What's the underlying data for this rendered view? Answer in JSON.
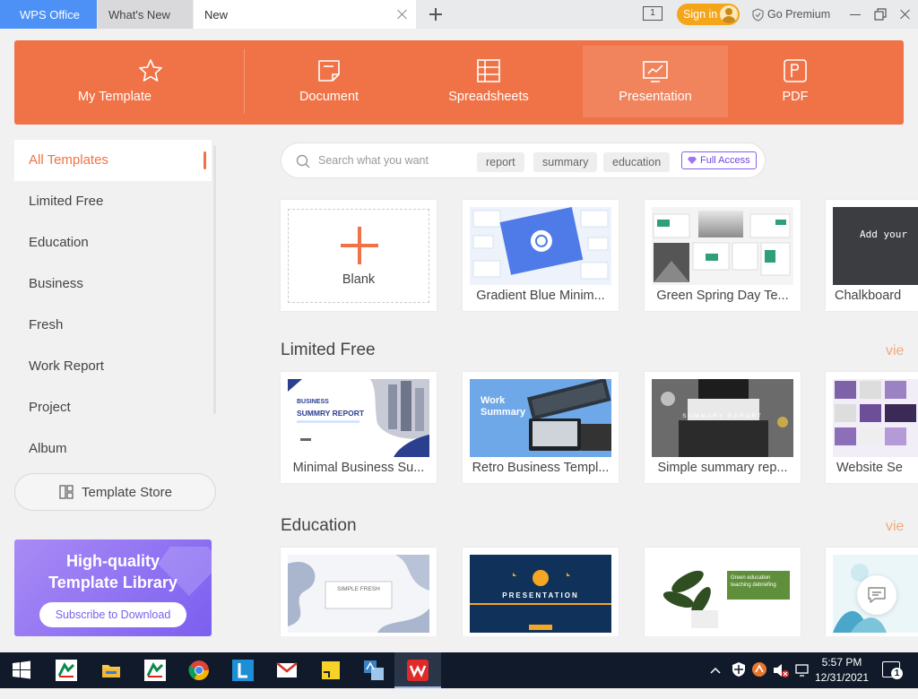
{
  "tabs": {
    "wps": "WPS Office",
    "whats_new": "What's New",
    "new": "New",
    "window_count": "1",
    "sign_in": "Sign in",
    "go_premium": "Go Premium"
  },
  "categories": [
    {
      "label": "My Template",
      "icon": "star-icon"
    },
    {
      "label": "Document",
      "icon": "document-icon"
    },
    {
      "label": "Spreadsheets",
      "icon": "spreadsheet-icon"
    },
    {
      "label": "Presentation",
      "icon": "presentation-icon",
      "active": true
    },
    {
      "label": "PDF",
      "icon": "pdf-icon"
    }
  ],
  "sidebar": {
    "items": [
      {
        "label": "All Templates",
        "active": true
      },
      {
        "label": "Limited Free"
      },
      {
        "label": "Education"
      },
      {
        "label": "Business"
      },
      {
        "label": "Fresh"
      },
      {
        "label": "Work Report"
      },
      {
        "label": "Project"
      },
      {
        "label": "Album"
      }
    ],
    "store_button": "Template Store",
    "promo": {
      "line1": "High-quality",
      "line2": "Template Library",
      "button": "Subscribe to Download"
    }
  },
  "search": {
    "placeholder": "Search what you want",
    "chips": [
      "report",
      "summary",
      "education"
    ],
    "full_access": "Full Access"
  },
  "top_row": {
    "blank_label": "Blank",
    "cards": [
      "Gradient Blue Minim...",
      "Green Spring Day Te...",
      "Chalkboard"
    ]
  },
  "sections": [
    {
      "title": "Limited Free",
      "view_more": "vie",
      "cards": [
        "Minimal Business Su...",
        "Retro Business Templ...",
        "Simple summary rep...",
        "Website Se"
      ]
    },
    {
      "title": "Education",
      "view_more": "vie",
      "cards": [
        "",
        "",
        "",
        ""
      ]
    }
  ],
  "thumb_text": {
    "chalk": "Add your",
    "business_small": "BUSINESS",
    "business_big": "SUMMRY REPORT",
    "work_summary_1": "Work",
    "work_summary_2": "Summary",
    "summary_report": "SUMMARY REPORT",
    "simple_fresh": "SIMPLE FRESH",
    "presentation": "PRESENTATION",
    "green_education": "Green education teaching debriefing"
  },
  "taskbar": {
    "time": "5:57 PM",
    "date": "12/31/2021",
    "notifications": "1"
  },
  "colors": {
    "accent": "#f07347",
    "tab_blue": "#4d90f6",
    "sign_in": "#f5a519",
    "promo": "#7b5ff0"
  }
}
